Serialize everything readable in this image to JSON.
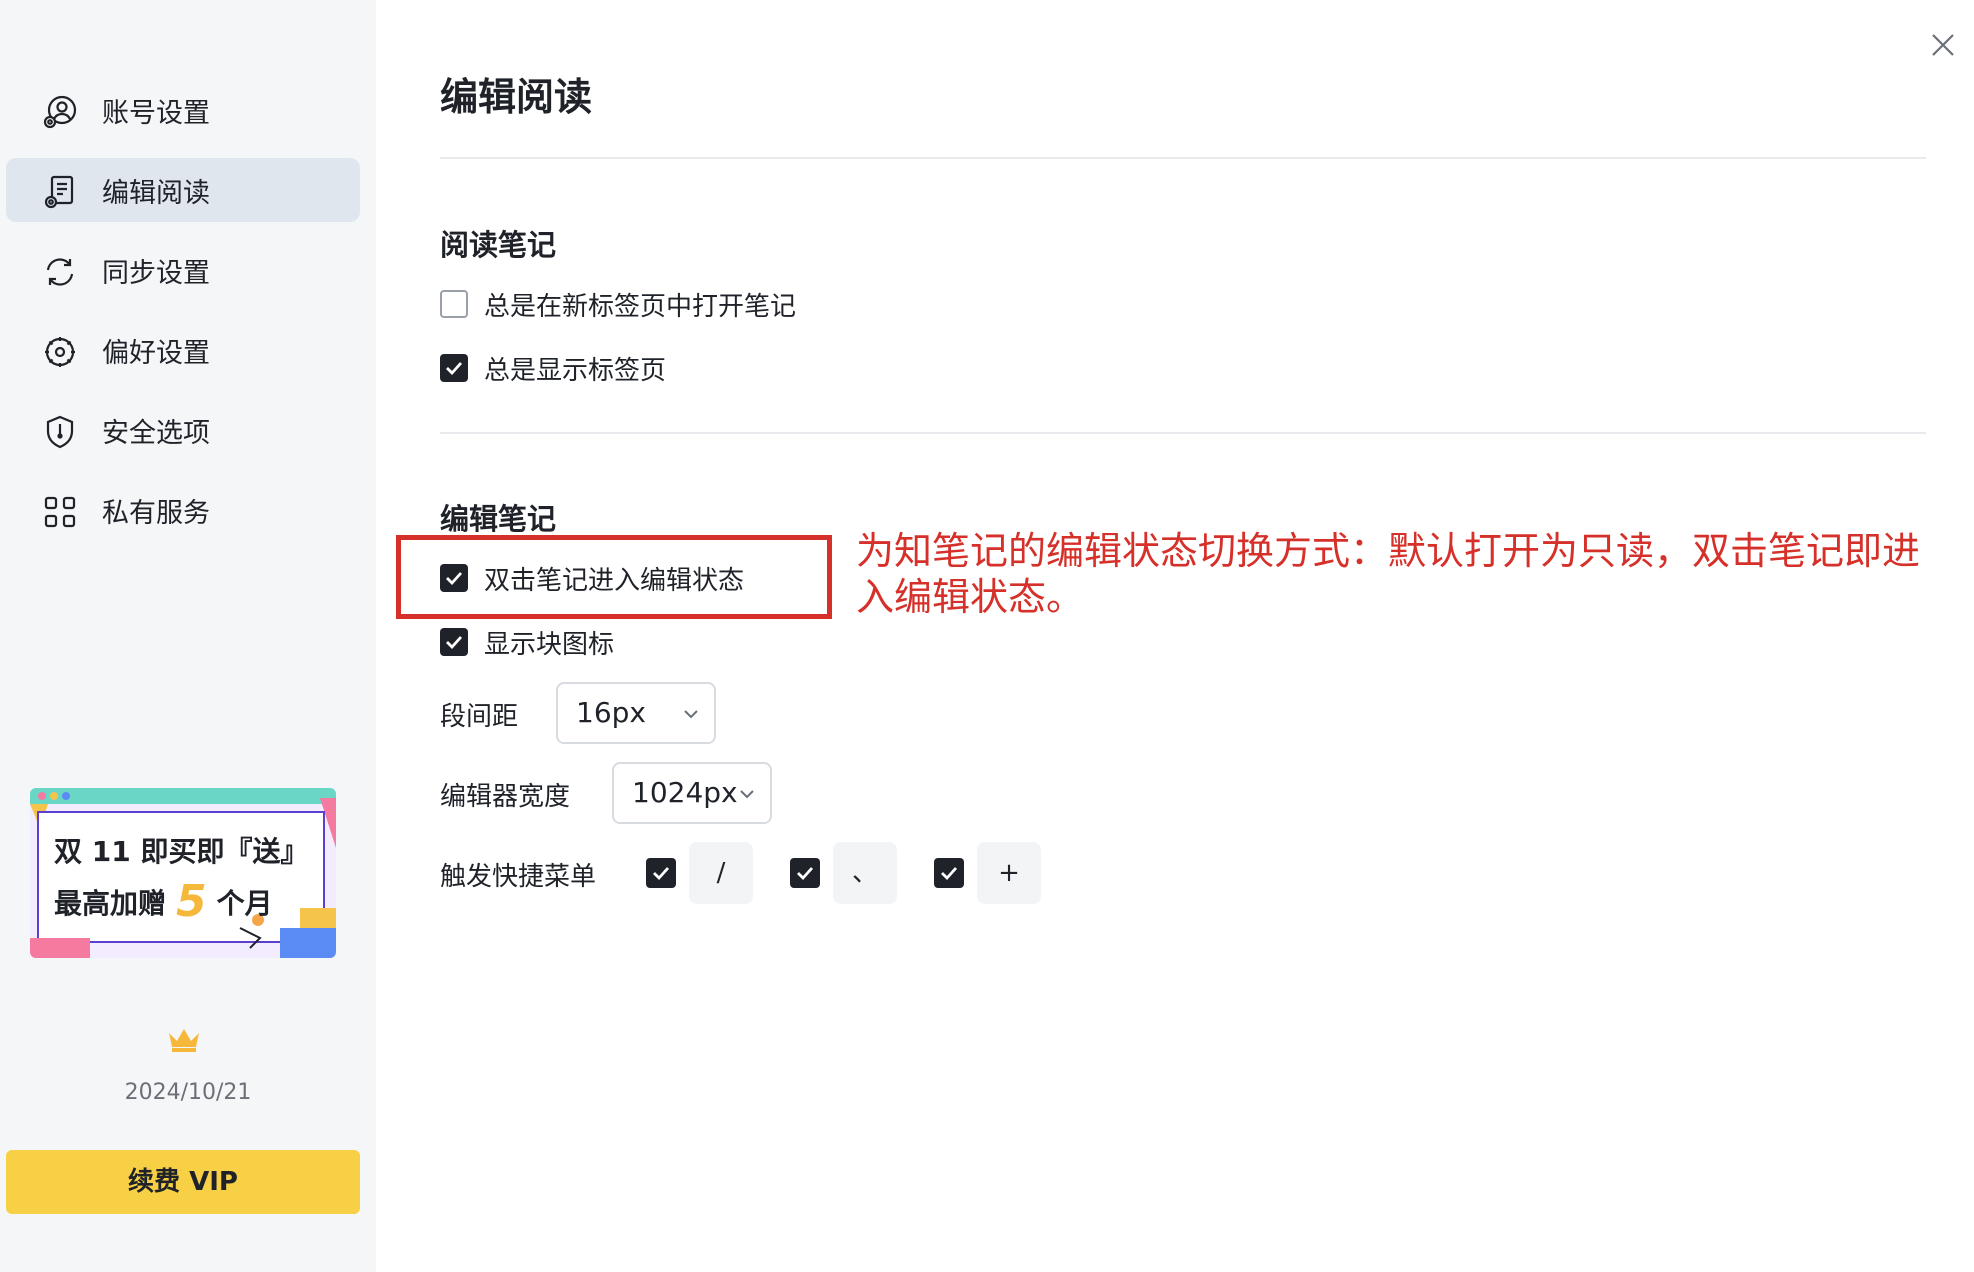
{
  "sidebar": {
    "items": [
      {
        "label": "账号设置",
        "icon": "account-settings-icon",
        "active": false
      },
      {
        "label": "编辑阅读",
        "icon": "edit-read-icon",
        "active": true
      },
      {
        "label": "同步设置",
        "icon": "sync-icon",
        "active": false
      },
      {
        "label": "偏好设置",
        "icon": "preferences-icon",
        "active": false
      },
      {
        "label": "安全选项",
        "icon": "shield-icon",
        "active": false
      },
      {
        "label": "私有服务",
        "icon": "private-service-icon",
        "active": false
      }
    ],
    "banner": {
      "line1": "双 11 即买即『送』",
      "line2_prefix": "最高加赠",
      "line2_number": "5",
      "line2_suffix": "个月"
    },
    "expire_date": "2024/10/21",
    "vip_button": "续费 VIP"
  },
  "main": {
    "title": "编辑阅读",
    "reading_section": {
      "title": "阅读笔记",
      "options": [
        {
          "label": "总是在新标签页中打开笔记",
          "checked": false
        },
        {
          "label": "总是显示标签页",
          "checked": true
        }
      ]
    },
    "editing_section": {
      "title": "编辑笔记",
      "options": [
        {
          "label": "双击笔记进入编辑状态",
          "checked": true
        },
        {
          "label": "显示块图标",
          "checked": true
        }
      ],
      "paragraph_spacing": {
        "label": "段间距",
        "value": "16px"
      },
      "editor_width": {
        "label": "编辑器宽度",
        "value": "1024px"
      },
      "hotkeys": {
        "label": "触发快捷菜单",
        "keys": [
          {
            "key": "/",
            "checked": true
          },
          {
            "key": "、",
            "checked": true
          },
          {
            "key": "+",
            "checked": true
          }
        ]
      }
    }
  },
  "annotation": {
    "text": "为知笔记的编辑状态切换方式：默认打开为只读，双击笔记即进入编辑状态。",
    "color": "#d6302a"
  },
  "colors": {
    "accent_vip": "#f7d046",
    "active_nav": "#dfe6ee",
    "checkbox": "#1f2329"
  }
}
